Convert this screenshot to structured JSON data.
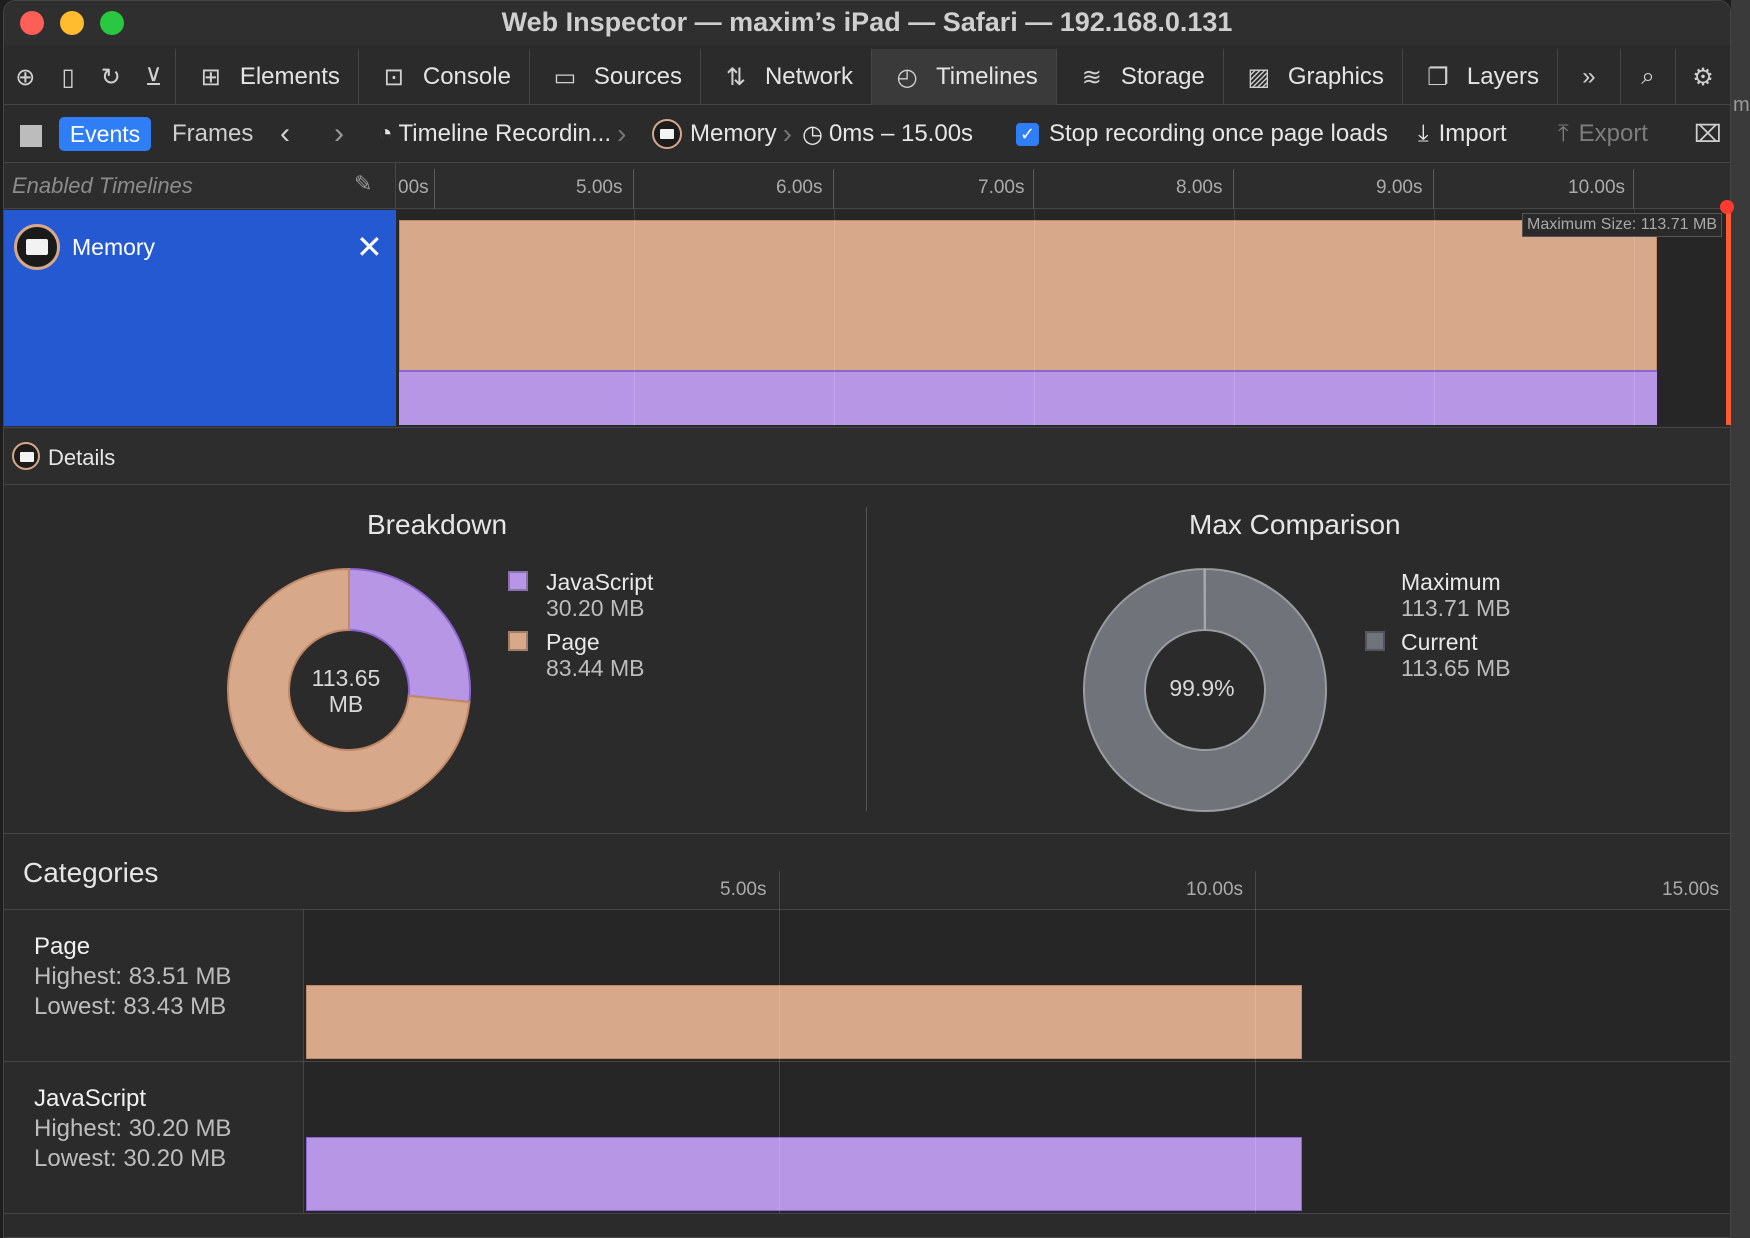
{
  "window": {
    "title": "Web Inspector — maxim’s iPad — Safari — 192.168.0.131"
  },
  "colors": {
    "page": "#d8a88a",
    "javascript": "#b896e6",
    "accent": "#2f7ef6",
    "max_current": "#70737a",
    "memory_selected": "#2459d2"
  },
  "toolbar": {
    "icons": [
      "crosshair-icon",
      "device-icon",
      "reload-icon",
      "download-icon"
    ],
    "tabs": [
      {
        "label": "Elements",
        "icon": "elements-icon"
      },
      {
        "label": "Console",
        "icon": "console-icon"
      },
      {
        "label": "Sources",
        "icon": "sources-icon"
      },
      {
        "label": "Network",
        "icon": "network-icon"
      },
      {
        "label": "Timelines",
        "icon": "timelines-icon",
        "active": true
      },
      {
        "label": "Storage",
        "icon": "storage-icon"
      },
      {
        "label": "Graphics",
        "icon": "graphics-icon"
      },
      {
        "label": "Layers",
        "icon": "layers-icon"
      }
    ]
  },
  "controls": {
    "events": "Events",
    "frames": "Frames",
    "recording": "Timeline Recordin...",
    "memory": "Memory",
    "range": "0ms – 15.00s",
    "stop_label": "Stop recording once page loads",
    "stop_checked": true,
    "import": "Import",
    "export": "Export"
  },
  "timeline": {
    "enabled_label": "Enabled Timelines",
    "ticks": [
      "00s",
      "5.00s",
      "6.00s",
      "7.00s",
      "8.00s",
      "9.00s",
      "10.00s"
    ],
    "memory_label": "Memory",
    "max_size": "Maximum Size: 113.71 MB"
  },
  "details": {
    "label": "Details"
  },
  "breakdown": {
    "title": "Breakdown",
    "center_value": "113.65",
    "center_unit": "MB",
    "items": [
      {
        "name": "JavaScript",
        "value": "30.20 MB",
        "mb": 30.2
      },
      {
        "name": "Page",
        "value": "83.44 MB",
        "mb": 83.44
      }
    ]
  },
  "max_comparison": {
    "title": "Max Comparison",
    "center": "99.9%",
    "maximum_label": "Maximum",
    "maximum_value": "113.71 MB",
    "current_label": "Current",
    "current_value": "113.65 MB",
    "fraction": 0.999
  },
  "categories": {
    "title": "Categories",
    "ticks": [
      "5.00s",
      "10.00s",
      "15.00s"
    ],
    "rows": [
      {
        "name": "Page",
        "highest": "Highest: 83.51 MB",
        "lowest": "Lowest: 83.43 MB"
      },
      {
        "name": "JavaScript",
        "highest": "Highest: 30.20 MB",
        "lowest": "Lowest: 30.20 MB"
      }
    ],
    "recording_end_fraction": 0.699
  }
}
